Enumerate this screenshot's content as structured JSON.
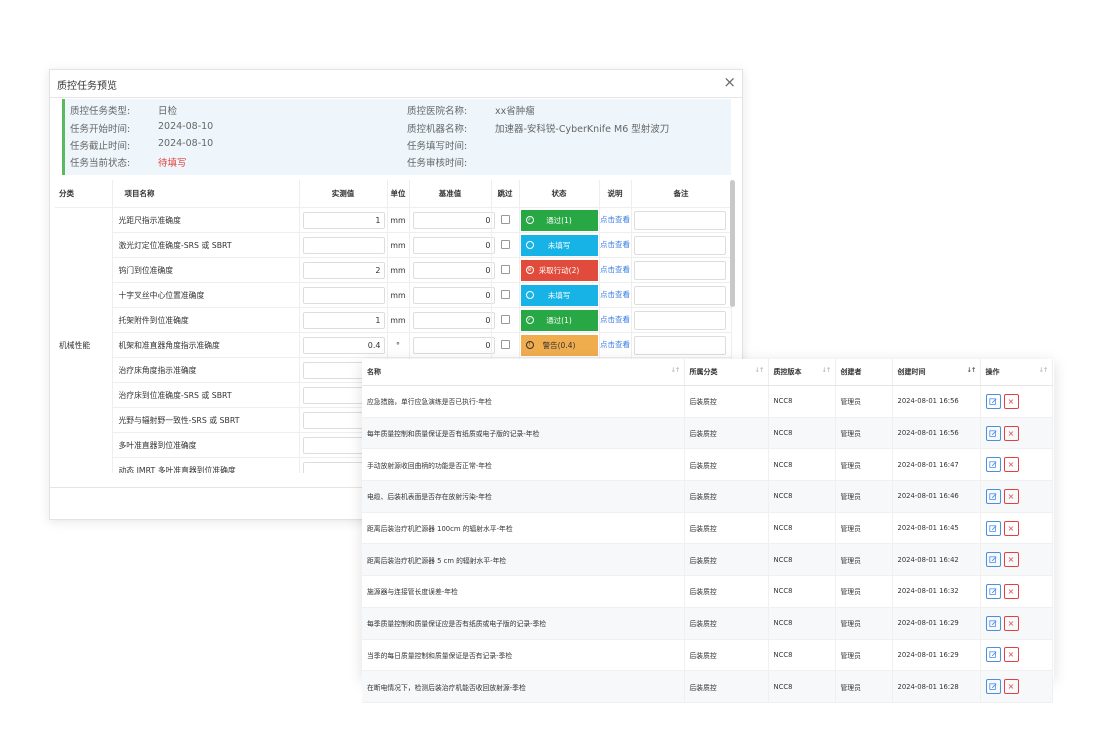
{
  "modal": {
    "title": "质控任务预览",
    "close": "×",
    "info": {
      "task_type_label": "质控任务类型:",
      "task_type": "日检",
      "start_label": "任务开始时间:",
      "start": "2024-08-10",
      "end_label": "任务截止时间:",
      "end": "2024-08-10",
      "state_label": "任务当前状态:",
      "state": "待填写",
      "hospital_label": "质控医院名称:",
      "hospital": "xx省肿瘤",
      "machine_label": "质控机器名称:",
      "machine": "加速器-安科锐-CyberKnife M6 型射波刀",
      "fill_time_label": "任务填写时间:",
      "audit_time_label": "任务审核时间:"
    },
    "columns": [
      "分类",
      "项目名称",
      "实测值",
      "单位",
      "基准值",
      "跳过",
      "状态",
      "说明",
      "备注"
    ],
    "category": "机械性能",
    "rows": [
      {
        "name": "光距尺指示准确度",
        "measured": "1",
        "unit": "mm",
        "base": "0",
        "status": "通过(1)",
        "status_type": "green",
        "link": "点击查看"
      },
      {
        "name": "激光灯定位准确度-SRS 或 SBRT",
        "measured": "",
        "unit": "mm",
        "base": "0",
        "status": "未填写",
        "status_type": "blue",
        "link": "点击查看"
      },
      {
        "name": "钨门到位准确度",
        "measured": "2",
        "unit": "mm",
        "base": "0",
        "status": "采取行动(2)",
        "status_type": "red",
        "link": "点击查看"
      },
      {
        "name": "十字叉丝中心位置准确度",
        "measured": "",
        "unit": "mm",
        "base": "0",
        "status": "未填写",
        "status_type": "blue",
        "link": "点击查看"
      },
      {
        "name": "托架附件到位准确度",
        "measured": "1",
        "unit": "mm",
        "base": "0",
        "status": "通过(1)",
        "status_type": "green",
        "link": "点击查看"
      },
      {
        "name": "机架和准直器角度指示准确度",
        "measured": "0.4",
        "unit": "°",
        "base": "0",
        "status": "警告(0.4)",
        "status_type": "orange",
        "link": "点击查看"
      },
      {
        "name": "治疗床角度指示准确度",
        "measured": "",
        "unit": "",
        "base": "",
        "status": "",
        "status_type": "",
        "link": ""
      },
      {
        "name": "治疗床到位准确度-SRS 或 SBRT",
        "measured": "",
        "unit": "",
        "base": "",
        "status": "",
        "status_type": "",
        "link": ""
      },
      {
        "name": "光野与辐射野一致性-SRS 或 SBRT",
        "measured": "",
        "unit": "",
        "base": "",
        "status": "",
        "status_type": "",
        "link": ""
      },
      {
        "name": "多叶准直器到位准确度",
        "measured": "",
        "unit": "",
        "base": "",
        "status": "",
        "status_type": "",
        "link": ""
      },
      {
        "name": "动态 IMRT 多叶准直器到位准确度",
        "measured": "",
        "unit": "",
        "base": "",
        "status": "",
        "status_type": "",
        "link": ""
      }
    ]
  },
  "panel": {
    "columns": [
      "名称",
      "所属分类",
      "质控版本",
      "创建者",
      "创建时间",
      "操作"
    ],
    "rows": [
      {
        "name": "应急措施，单行应急演练是否已执行-年检",
        "category": "后装质控",
        "version": "NCC8",
        "creator": "管理员",
        "time": "2024-08-01 16:56"
      },
      {
        "name": "每年质量控制和质量保证是否有纸质或电子版的记录-年检",
        "category": "后装质控",
        "version": "NCC8",
        "creator": "管理员",
        "time": "2024-08-01 16:56"
      },
      {
        "name": "手动放射源收回曲柄的功能是否正常-年检",
        "category": "后装质控",
        "version": "NCC8",
        "creator": "管理员",
        "time": "2024-08-01 16:47"
      },
      {
        "name": "电缆、后装机表面是否存在放射污染-年检",
        "category": "后装质控",
        "version": "NCC8",
        "creator": "管理员",
        "time": "2024-08-01 16:46"
      },
      {
        "name": "距离后装治疗机贮源器 100cm 的辐射水平-年检",
        "category": "后装质控",
        "version": "NCC8",
        "creator": "管理员",
        "time": "2024-08-01 16:45"
      },
      {
        "name": "距离后装治疗机贮源器 5 cm 的辐射水平-年检",
        "category": "后装质控",
        "version": "NCC8",
        "creator": "管理员",
        "time": "2024-08-01 16:42"
      },
      {
        "name": "施源器与连接管长度误差-年检",
        "category": "后装质控",
        "version": "NCC8",
        "creator": "管理员",
        "time": "2024-08-01 16:32"
      },
      {
        "name": "每季质量控制和质量保证应是否有纸质或电子版的记录-季检",
        "category": "后装质控",
        "version": "NCC8",
        "creator": "管理员",
        "time": "2024-08-01 16:29"
      },
      {
        "name": "当季的每日质量控制和质量保证是否有记录-季检",
        "category": "后装质控",
        "version": "NCC8",
        "creator": "管理员",
        "time": "2024-08-01 16:29"
      },
      {
        "name": "在断电情况下，检测后装治疗机能否收回放射源-季检",
        "category": "后装质控",
        "version": "NCC8",
        "creator": "管理员",
        "time": "2024-08-01 16:28"
      }
    ],
    "edit_icon": "edit-icon",
    "delete_icon": "×"
  }
}
